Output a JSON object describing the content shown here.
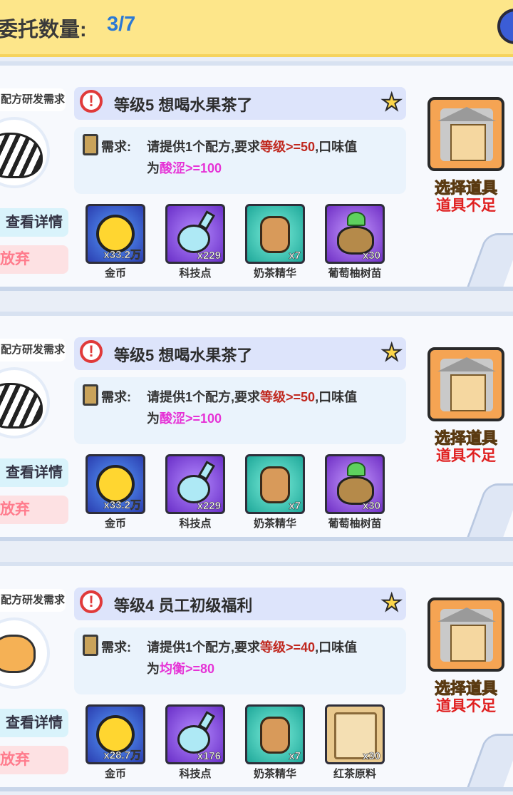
{
  "header": {
    "title": "委托数量:",
    "count": "3/7"
  },
  "cards": [
    {
      "tag": "配方研发需求",
      "avatar": "zebra",
      "title": "等级5 想喝水果茶了",
      "req_label": "需求:",
      "req_line1_a": "请提供1个配方,要求",
      "req_line1_b": "等级",
      "req_line1_c": ">=50",
      "req_line1_d": ",口味值",
      "req_line2_a": "为",
      "req_line2_b": "酸涩>=100",
      "detail_label": "查看详情",
      "abandon_label": "放弃",
      "select_label": "选择道具",
      "insufficient_label": "道具不足",
      "rewards": [
        {
          "name": "金币",
          "qty": "x33.2万",
          "icon": "coin-icon"
        },
        {
          "name": "科技点",
          "qty": "x229",
          "icon": "flask-icon"
        },
        {
          "name": "奶茶精华",
          "qty": "x7",
          "icon": "tea-jar-icon"
        },
        {
          "name": "葡萄柚树苗",
          "qty": "x30",
          "icon": "seed-bag-icon"
        }
      ]
    },
    {
      "tag": "配方研发需求",
      "avatar": "zebra",
      "title": "等级5 想喝水果茶了",
      "req_label": "需求:",
      "req_line1_a": "请提供1个配方,要求",
      "req_line1_b": "等级",
      "req_line1_c": ">=50",
      "req_line1_d": ",口味值",
      "req_line2_a": "为",
      "req_line2_b": "酸涩>=100",
      "detail_label": "查看详情",
      "abandon_label": "放弃",
      "select_label": "选择道具",
      "insufficient_label": "道具不足",
      "rewards": [
        {
          "name": "金币",
          "qty": "x33.2万",
          "icon": "coin-icon"
        },
        {
          "name": "科技点",
          "qty": "x229",
          "icon": "flask-icon"
        },
        {
          "name": "奶茶精华",
          "qty": "x7",
          "icon": "tea-jar-icon"
        },
        {
          "name": "葡萄柚树苗",
          "qty": "x30",
          "icon": "seed-bag-icon"
        }
      ]
    },
    {
      "tag": "配方研发需求",
      "avatar": "cat",
      "title": "等级4 员工初级福利",
      "req_label": "需求:",
      "req_line1_a": "请提供1个配方,要求",
      "req_line1_b": "等级",
      "req_line1_c": ">=40",
      "req_line1_d": ",口味值",
      "req_line2_a": "为",
      "req_line2_b": "均衡>=80",
      "detail_label": "查看详情",
      "abandon_label": "放弃",
      "select_label": "选择道具",
      "insufficient_label": "道具不足",
      "rewards": [
        {
          "name": "金币",
          "qty": "x28.7万",
          "icon": "coin-icon"
        },
        {
          "name": "科技点",
          "qty": "x176",
          "icon": "flask-icon"
        },
        {
          "name": "奶茶精华",
          "qty": "x7",
          "icon": "tea-jar-icon"
        },
        {
          "name": "红茶原料",
          "qty": "x30",
          "icon": "black-tea-crate-icon"
        }
      ]
    }
  ],
  "colors": {
    "header_bg": "#fde68a",
    "count": "#2b79d4",
    "requirement_level": "#c0281f",
    "requirement_flavor": "#e633d6",
    "insufficient": "#e02020"
  }
}
